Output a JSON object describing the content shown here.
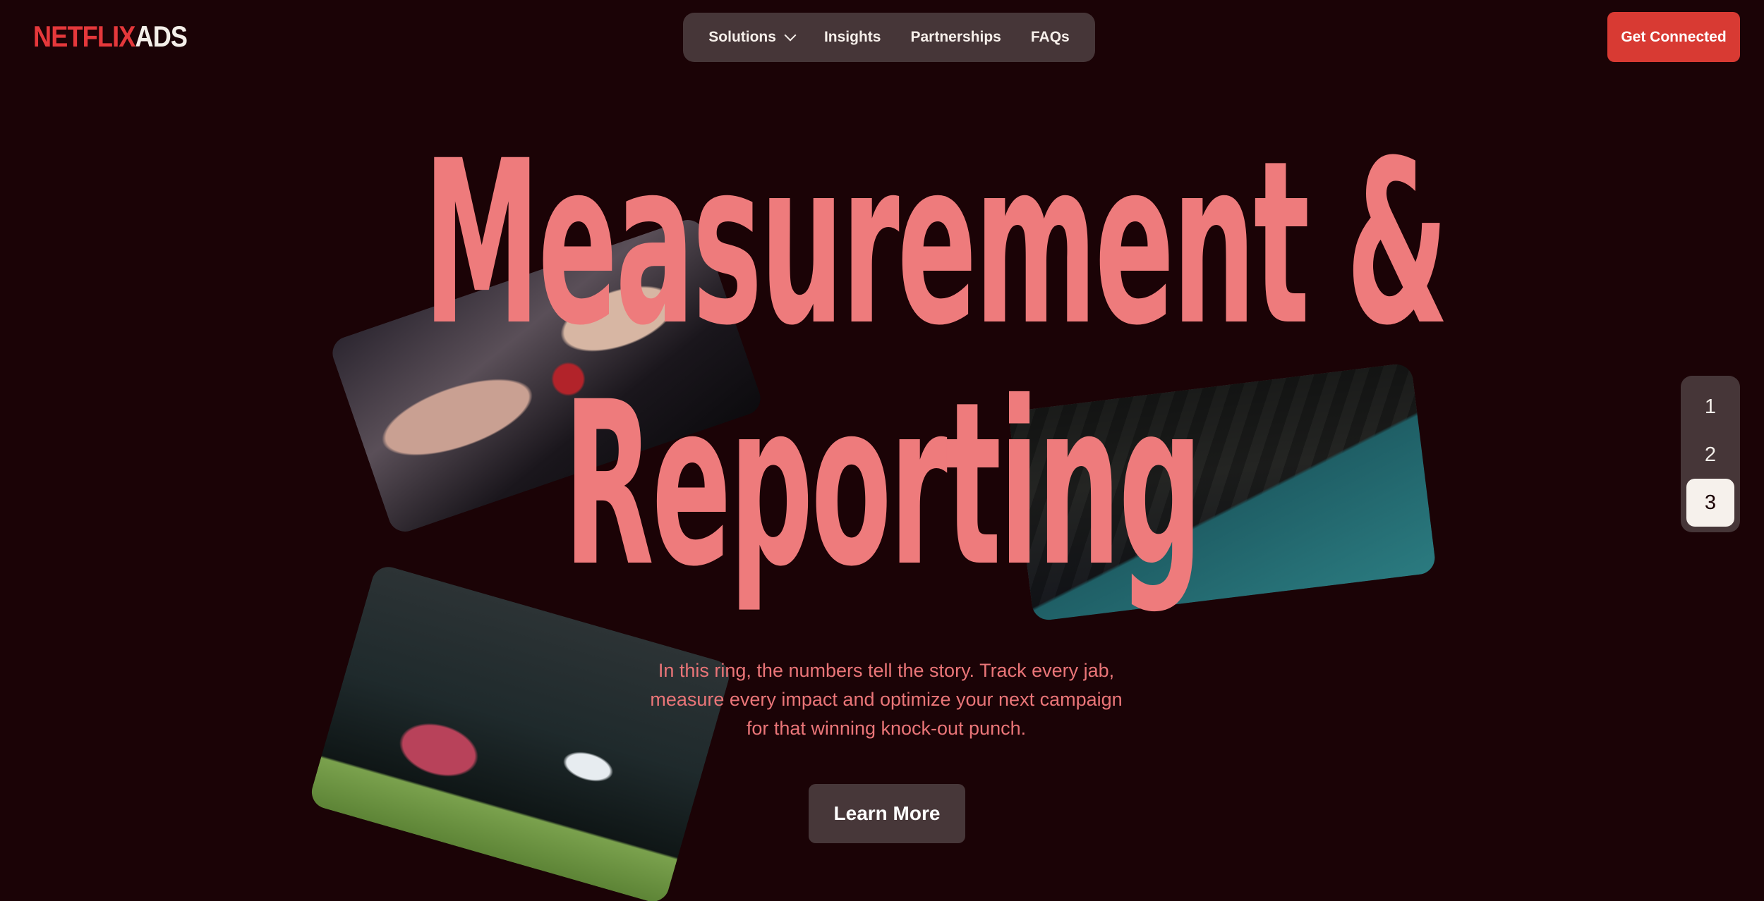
{
  "header": {
    "logo": {
      "brand": "NETFLIX",
      "suffix": "ADS"
    },
    "nav": [
      {
        "label": "Solutions",
        "has_dropdown": true
      },
      {
        "label": "Insights"
      },
      {
        "label": "Partnerships"
      },
      {
        "label": "FAQs"
      }
    ],
    "cta_label": "Get Connected"
  },
  "hero": {
    "headline_line1": "Measurement &",
    "headline_line2": "Reporting",
    "description": "In this ring, the numbers tell the story. Track every jab, measure every impact and optimize your next campaign for that winning knock-out punch.",
    "button_label": "Learn More"
  },
  "pagination": {
    "items": [
      "1",
      "2",
      "3"
    ],
    "active": "3"
  },
  "colors": {
    "background": "#1b0306",
    "accent": "#d83a33",
    "headline": "#ee7b7c",
    "nav_bg": "#463638"
  }
}
